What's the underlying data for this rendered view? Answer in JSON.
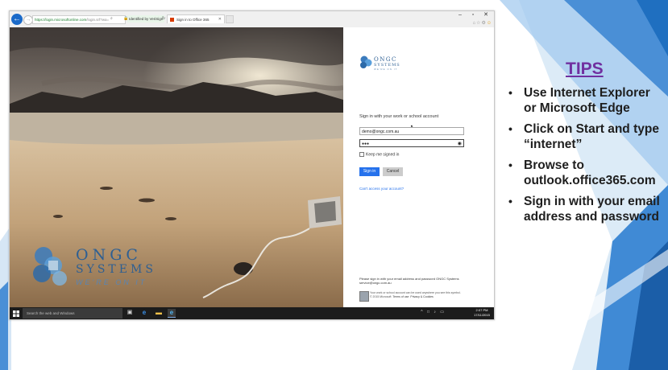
{
  "browser": {
    "url_prefix": "https://login.microsoftonline.com",
    "url_rest": "/login.srf?wa=",
    "identity": "Identified by VeriSign",
    "tab_title": "Sign in to Office 365",
    "window_controls": {
      "minimize": "–",
      "restore": "▫",
      "close": "✕"
    }
  },
  "brand": {
    "name_line1": "ONGC",
    "name_line2": "SYSTEMS",
    "tagline": "WE'RE ON IT"
  },
  "signin": {
    "heading": "Sign in with your work or school account",
    "email_value": "demo@ongc.com.au",
    "password_masked": "●●●",
    "keep_signed_in": "Keep me signed in",
    "signin_button": "Sign in",
    "cancel_button": "Cancel",
    "cant_access": "Can't access your account?",
    "footer_message": "Please sign in with your email address and password ONGC Systems service@ongc.com.au",
    "footer_note": "Your work or school account can be used anywhere you see this symbol.",
    "copyright": "© 2015 Microsoft",
    "terms": "Terms of use",
    "privacy": "Privacy & Cookies"
  },
  "taskbar": {
    "search_placeholder": "Search the web and Windows",
    "time": "2:07 PM",
    "date": "17/11/2015"
  },
  "tips": {
    "title": "TIPS",
    "items": [
      "Use Internet Explorer or Microsoft Edge",
      "Click on Start and type “internet”",
      "Browse to outlook.office365.com",
      "Sign in with your email address and password"
    ]
  },
  "colors": {
    "accent": "#2672ec",
    "tips_title": "#7030a0",
    "slide_blue": "#4a8fd6"
  }
}
